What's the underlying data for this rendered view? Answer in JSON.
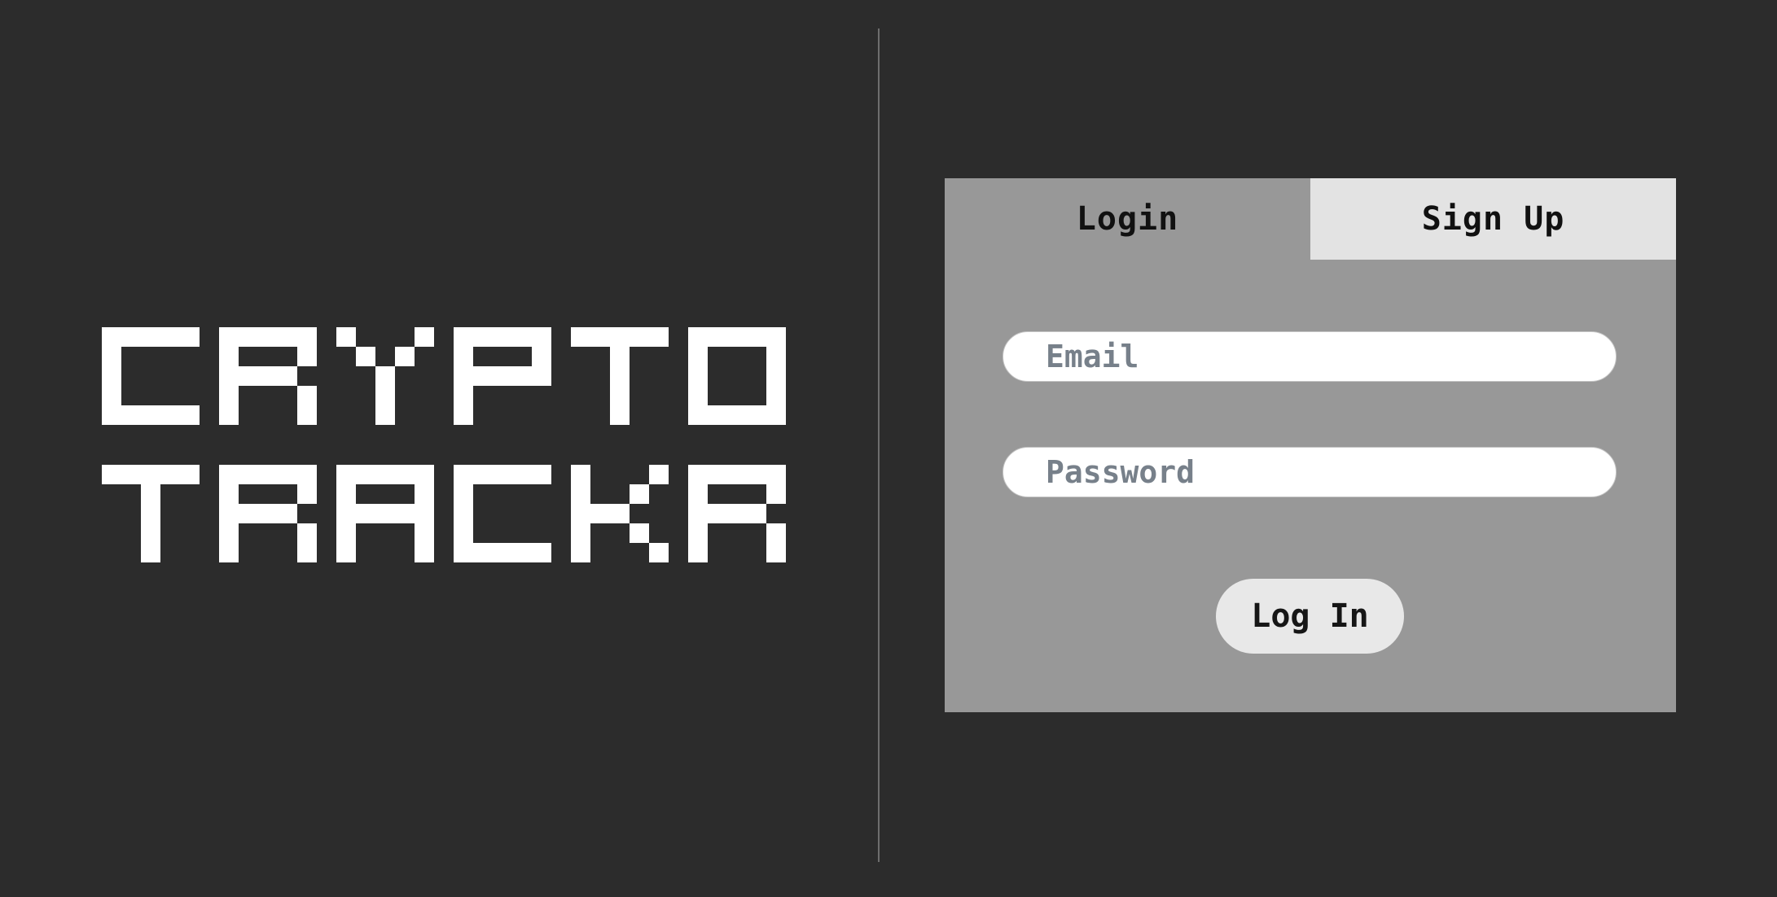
{
  "logo": {
    "line1": "CRYPTO",
    "line2": "TRACKR"
  },
  "auth": {
    "tabs": [
      {
        "label": "Login",
        "active": true
      },
      {
        "label": "Sign Up",
        "active": false
      }
    ],
    "email": {
      "placeholder": "Email",
      "value": ""
    },
    "password": {
      "placeholder": "Password",
      "value": ""
    },
    "submit_label": "Log In"
  },
  "colors": {
    "background": "#2c2c2c",
    "panel": "#989898",
    "inactive_tab": "#e3e3e3",
    "logo_text": "#ffffff",
    "input_placeholder": "#77808a"
  }
}
